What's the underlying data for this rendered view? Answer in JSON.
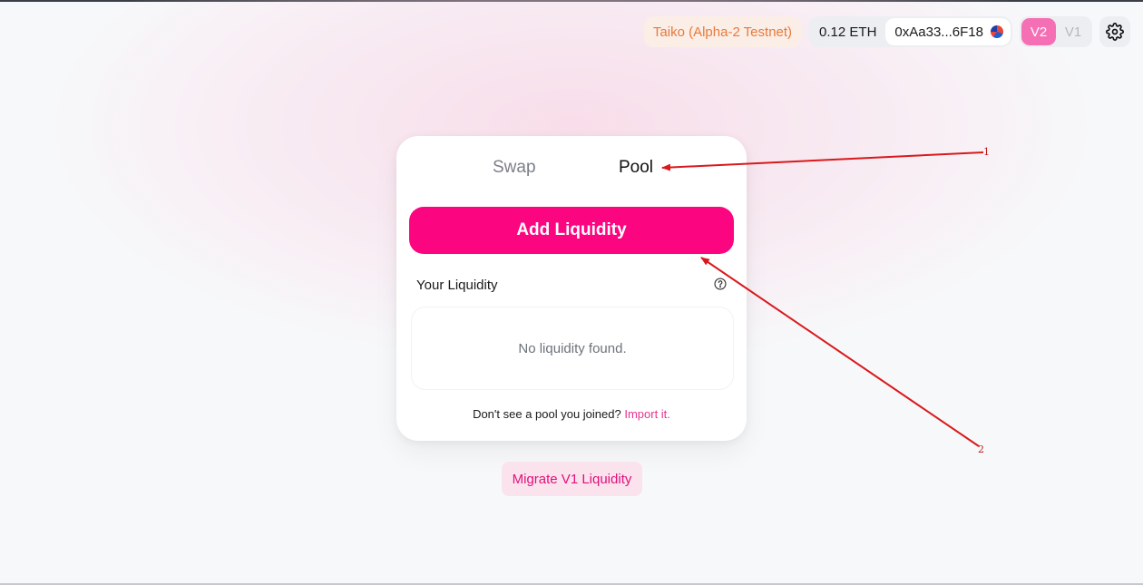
{
  "header": {
    "network": "Taiko (Alpha-2 Testnet)",
    "balance": "0.12 ETH",
    "address": "0xAa33...6F18",
    "versions": [
      "V2",
      "V1"
    ],
    "active_version": "V2",
    "settings_icon": "gear-icon"
  },
  "card": {
    "tabs": {
      "swap": "Swap",
      "pool": "Pool"
    },
    "add_liquidity_label": "Add Liquidity",
    "your_liquidity_label": "Your Liquidity",
    "help_icon": "question-circle-icon",
    "empty_state": "No liquidity found.",
    "import_prompt": "Don't see a pool you joined?",
    "import_link": "Import it."
  },
  "migrate_label": "Migrate V1 Liquidity",
  "annotations": {
    "labels": [
      "1",
      "2"
    ],
    "color": "#d9191c"
  },
  "colors": {
    "accent": "#fc0580",
    "network_text": "#e87a3a",
    "v2_active": "#f56fb4"
  }
}
